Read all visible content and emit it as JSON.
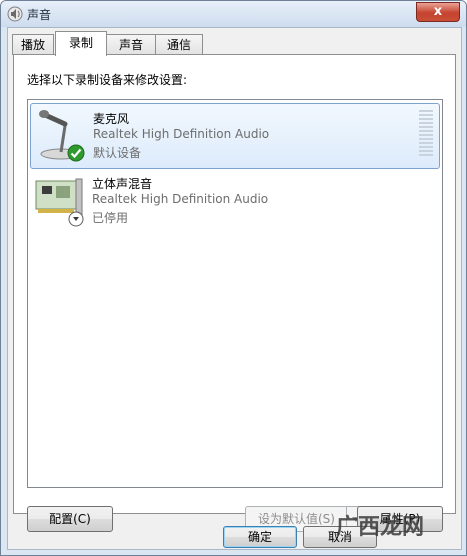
{
  "window": {
    "title": "声音",
    "close_symbol": "x"
  },
  "tabs": [
    {
      "label": "播放",
      "active": false
    },
    {
      "label": "录制",
      "active": true
    },
    {
      "label": "声音",
      "active": false
    },
    {
      "label": "通信",
      "active": false
    }
  ],
  "panel": {
    "instruction": "选择以下录制设备来修改设置:"
  },
  "devices": [
    {
      "name": "麦克风",
      "driver": "Realtek High Definition Audio",
      "status": "默认设备",
      "icon": "microphone-icon",
      "badge": "green-check-icon",
      "selected": true
    },
    {
      "name": "立体声混音",
      "driver": "Realtek High Definition Audio",
      "status": "已停用",
      "icon": "sound-card-icon",
      "badge": "disabled-arrow-icon",
      "selected": false
    }
  ],
  "buttons": {
    "configure": "配置(C)",
    "set_default": "设为默认值(S)",
    "properties": "属性(P)",
    "ok": "确定",
    "cancel": "取消"
  },
  "watermark": "广西龙网",
  "colors": {
    "selection": "#dcebfc",
    "check": "#2f9b2f"
  }
}
